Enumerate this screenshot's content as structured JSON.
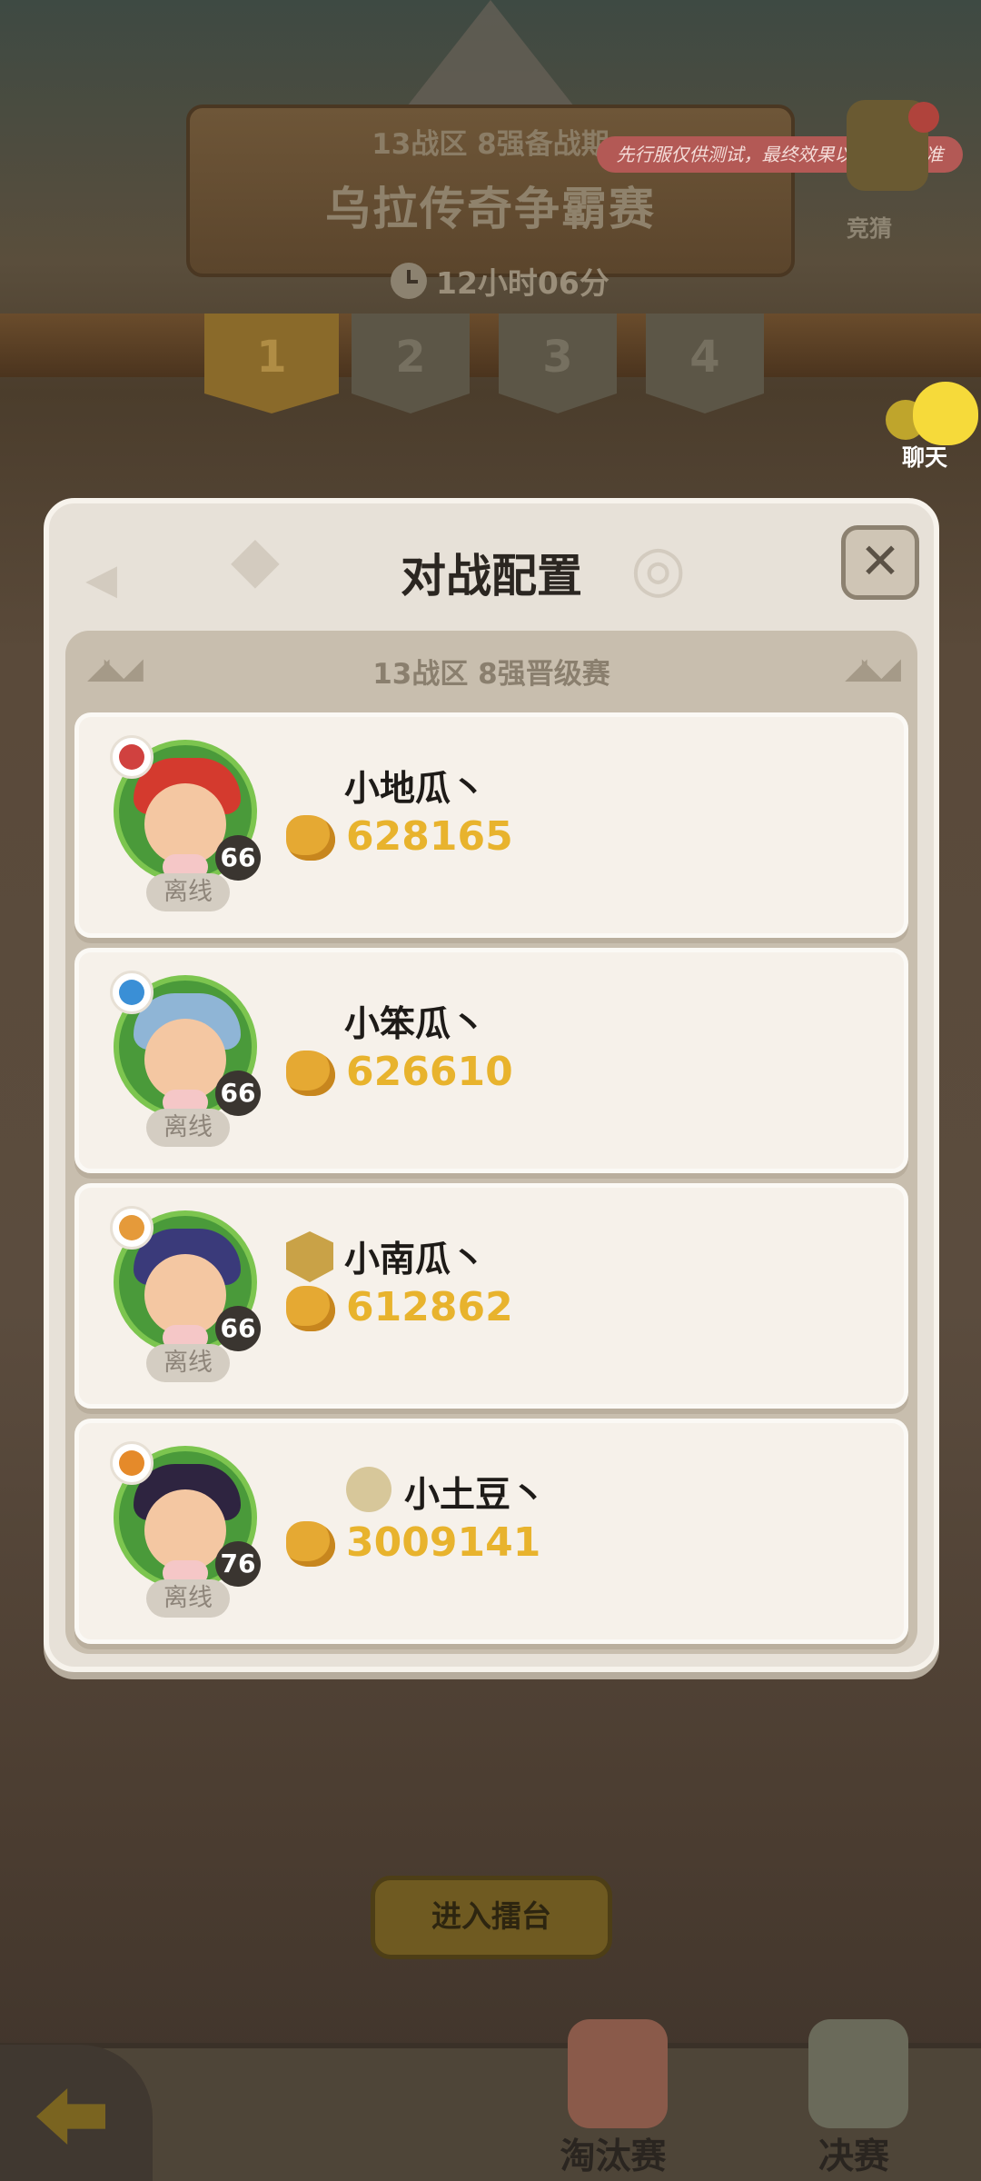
{
  "header": {
    "season": "13战区 8强备战期",
    "title": "乌拉传奇争霸赛",
    "timer": "12小时06分",
    "notice": "先行服仅供测试，最终效果以正式服为准",
    "guess_label": "竞猜",
    "chat_label": "聊天"
  },
  "round_tabs": [
    "1",
    "2",
    "3",
    "4"
  ],
  "modal": {
    "title": "对战配置",
    "close_symbol": "✕",
    "subtitle": "13战区 8强晋级赛",
    "players": [
      {
        "name": "小地瓜丶",
        "power": "628165",
        "level": "66",
        "status": "离线",
        "hair_color": "#d43a2e",
        "class_color": "#d0413f"
      },
      {
        "name": "小笨瓜丶",
        "power": "626610",
        "level": "66",
        "status": "离线",
        "hair_color": "#8fb5d6",
        "class_color": "#3a8fd6"
      },
      {
        "name": "小南瓜丶",
        "power": "612862",
        "level": "66",
        "status": "离线",
        "hair_color": "#3a3a7a",
        "class_color": "#e59a3a"
      },
      {
        "name": "小土豆丶",
        "power": "3009141",
        "level": "76",
        "status": "离线",
        "hair_color": "#2e2440",
        "class_color": "#e58a2a"
      }
    ]
  },
  "actions": {
    "enter_label": "进入擂台",
    "knockout_label": "淘汰赛",
    "final_label": "决赛"
  }
}
